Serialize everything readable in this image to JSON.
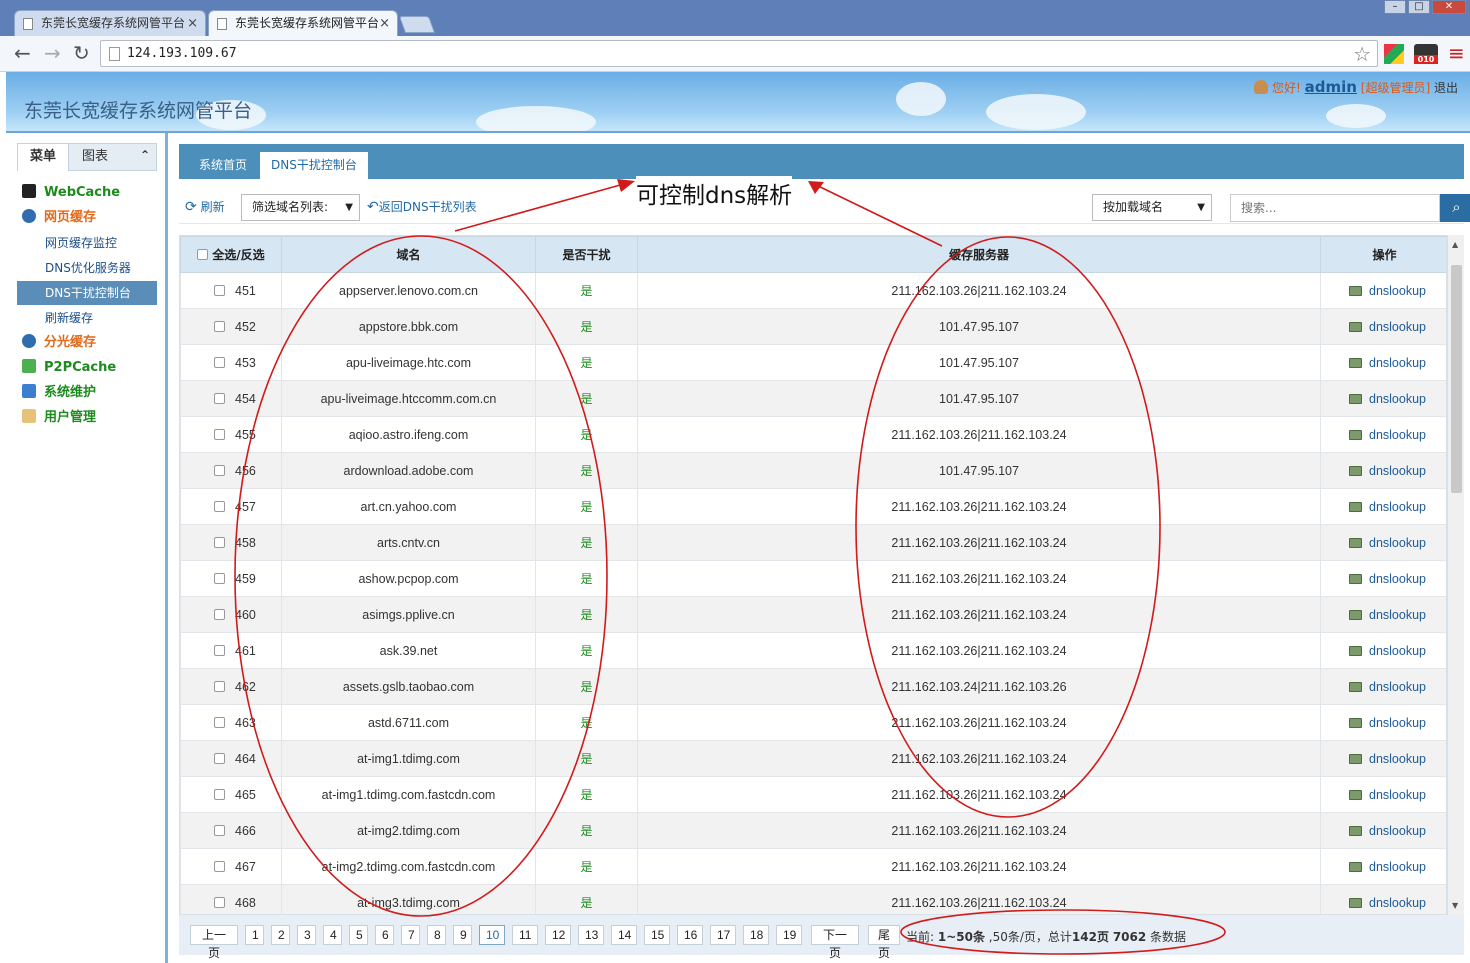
{
  "browser": {
    "tabs": [
      {
        "title": "东莞长宽缓存系统网管平台",
        "active": false
      },
      {
        "title": "东莞长宽缓存系统网管平台",
        "active": true
      }
    ],
    "url": "124.193.109.67",
    "ext_badge": "010"
  },
  "header": {
    "site_title": "东莞长宽缓存系统网管平台",
    "greeting": "您好!",
    "username": "admin",
    "role": "[超级管理员]",
    "logout": "退出"
  },
  "sidebar": {
    "tabs": [
      "菜单",
      "图表"
    ],
    "collapse_glyph": "⌃",
    "menu": [
      {
        "label": "WebCache",
        "color": "#1d8a1d"
      },
      {
        "label": "网页缓存",
        "color": "#e06a1c",
        "children": [
          "网页缓存监控",
          "DNS优化服务器",
          "DNS干扰控制台",
          "刷新缓存"
        ],
        "selected_child": 2
      },
      {
        "label": "分光缓存",
        "color": "#e06a1c"
      },
      {
        "label": "P2PCache",
        "color": "#1d8a1d"
      },
      {
        "label": "系统维护",
        "color": "#1d8a1d"
      },
      {
        "label": "用户管理",
        "color": "#1d8a1d"
      }
    ]
  },
  "main": {
    "breadcrumbs": [
      "系统首页",
      "DNS干扰控制台"
    ],
    "toolbar": {
      "refresh": "刷新",
      "filter_select": "筛选域名列表:",
      "back_link": "返回DNS干扰列表",
      "load_select": "按加载域名",
      "search_placeholder": "搜索..."
    },
    "table": {
      "headers": [
        "全选/反选",
        "域名",
        "是否干扰",
        "缓存服务器",
        "操作"
      ],
      "rows": [
        {
          "id": "451",
          "domain": "appserver.lenovo.com.cn",
          "intercept": "是",
          "servers": "211.162.103.26|211.162.103.24",
          "op": "dnslookup"
        },
        {
          "id": "452",
          "domain": "appstore.bbk.com",
          "intercept": "是",
          "servers": "101.47.95.107",
          "op": "dnslookup"
        },
        {
          "id": "453",
          "domain": "apu-liveimage.htc.com",
          "intercept": "是",
          "servers": "101.47.95.107",
          "op": "dnslookup"
        },
        {
          "id": "454",
          "domain": "apu-liveimage.htccomm.com.cn",
          "intercept": "是",
          "servers": "101.47.95.107",
          "op": "dnslookup"
        },
        {
          "id": "455",
          "domain": "aqioo.astro.ifeng.com",
          "intercept": "是",
          "servers": "211.162.103.26|211.162.103.24",
          "op": "dnslookup"
        },
        {
          "id": "456",
          "domain": "ardownload.adobe.com",
          "intercept": "是",
          "servers": "101.47.95.107",
          "op": "dnslookup"
        },
        {
          "id": "457",
          "domain": "art.cn.yahoo.com",
          "intercept": "是",
          "servers": "211.162.103.26|211.162.103.24",
          "op": "dnslookup"
        },
        {
          "id": "458",
          "domain": "arts.cntv.cn",
          "intercept": "是",
          "servers": "211.162.103.26|211.162.103.24",
          "op": "dnslookup"
        },
        {
          "id": "459",
          "domain": "ashow.pcpop.com",
          "intercept": "是",
          "servers": "211.162.103.26|211.162.103.24",
          "op": "dnslookup"
        },
        {
          "id": "460",
          "domain": "asimgs.pplive.cn",
          "intercept": "是",
          "servers": "211.162.103.26|211.162.103.24",
          "op": "dnslookup"
        },
        {
          "id": "461",
          "domain": "ask.39.net",
          "intercept": "是",
          "servers": "211.162.103.26|211.162.103.24",
          "op": "dnslookup"
        },
        {
          "id": "462",
          "domain": "assets.gslb.taobao.com",
          "intercept": "是",
          "servers": "211.162.103.24|211.162.103.26",
          "op": "dnslookup"
        },
        {
          "id": "463",
          "domain": "astd.6711.com",
          "intercept": "是",
          "servers": "211.162.103.26|211.162.103.24",
          "op": "dnslookup"
        },
        {
          "id": "464",
          "domain": "at-img1.tdimg.com",
          "intercept": "是",
          "servers": "211.162.103.26|211.162.103.24",
          "op": "dnslookup"
        },
        {
          "id": "465",
          "domain": "at-img1.tdimg.com.fastcdn.com",
          "intercept": "是",
          "servers": "211.162.103.26|211.162.103.24",
          "op": "dnslookup"
        },
        {
          "id": "466",
          "domain": "at-img2.tdimg.com",
          "intercept": "是",
          "servers": "211.162.103.26|211.162.103.24",
          "op": "dnslookup"
        },
        {
          "id": "467",
          "domain": "at-img2.tdimg.com.fastcdn.com",
          "intercept": "是",
          "servers": "211.162.103.26|211.162.103.24",
          "op": "dnslookup"
        },
        {
          "id": "468",
          "domain": "at-img3.tdimg.com",
          "intercept": "是",
          "servers": "211.162.103.26|211.162.103.24",
          "op": "dnslookup"
        }
      ]
    },
    "pager": {
      "prev": "上一页",
      "pages": [
        "1",
        "2",
        "3",
        "4",
        "5",
        "6",
        "7",
        "8",
        "9",
        "10",
        "11",
        "12",
        "13",
        "14",
        "15",
        "16",
        "17",
        "18",
        "19"
      ],
      "current": "10",
      "next": "下一页",
      "last": "尾页",
      "info_prefix": "当前: ",
      "info_range": "1~50条",
      "info_mid": " ,50条/页，总计",
      "info_pages": "142页",
      "info_sp": " ",
      "info_total": "7062",
      "info_suffix": " 条数据"
    }
  },
  "annotation": {
    "text": "可控制dns解析",
    "color": "#d11a1a"
  }
}
